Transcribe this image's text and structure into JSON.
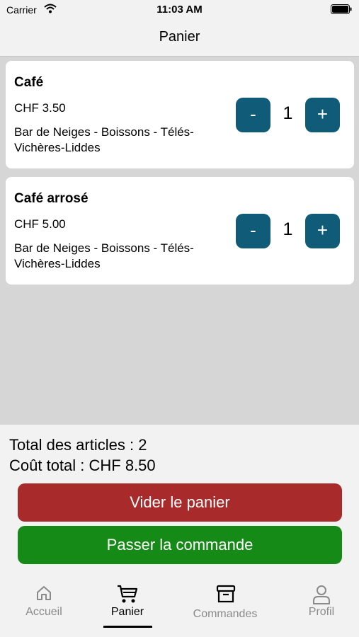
{
  "status_bar": {
    "carrier": "Carrier",
    "time": "11:03 AM"
  },
  "nav": {
    "title": "Panier"
  },
  "cart_items": [
    {
      "name": "Café",
      "price": "CHF 3.50",
      "location": "Bar de Neiges - Boissons - Télés-Vichères-Liddes",
      "quantity": "1",
      "minus_label": "-",
      "plus_label": "+"
    },
    {
      "name": "Café arrosé",
      "price": "CHF 5.00",
      "location": "Bar de Neiges - Boissons - Télés-Vichères-Liddes",
      "quantity": "1",
      "minus_label": "-",
      "plus_label": "+"
    }
  ],
  "summary": {
    "total_items": "Total des articles : 2",
    "total_cost": "Coût total : CHF 8.50"
  },
  "buttons": {
    "clear_cart": "Vider le panier",
    "place_order": "Passer la commande"
  },
  "tabs": [
    {
      "label": "Accueil",
      "icon": "home-icon",
      "active": false
    },
    {
      "label": "Panier",
      "icon": "cart-icon",
      "active": true
    },
    {
      "label": "Commandes",
      "icon": "archive-box-icon",
      "active": false
    },
    {
      "label": "Profil",
      "icon": "person-icon",
      "active": false
    }
  ],
  "colors": {
    "accent": "#0f5b78",
    "danger": "#a82a2a",
    "success": "#168a16",
    "background": "#d6d6d6"
  }
}
